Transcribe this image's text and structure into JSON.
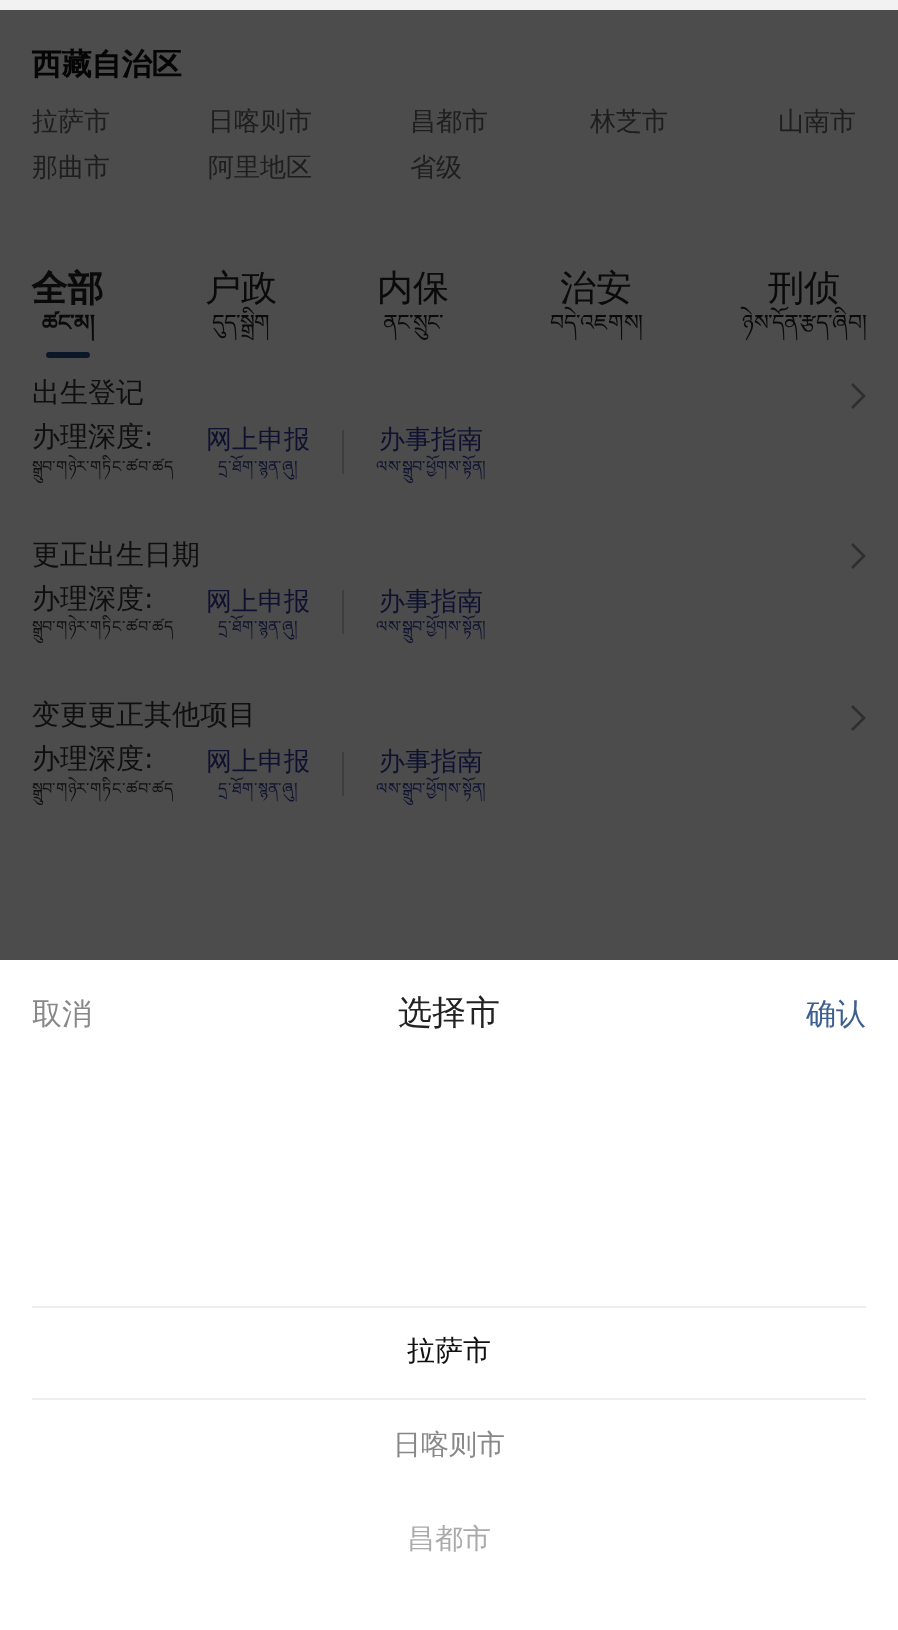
{
  "region": {
    "title": "西藏自治区",
    "cities": [
      "拉萨市",
      "日喀则市",
      "昌都市",
      "林芝市",
      "山南市",
      "那曲市",
      "阿里地区",
      "省级"
    ]
  },
  "tabs": [
    {
      "label": "全部",
      "sub": "ཚང་མ།",
      "selected": true
    },
    {
      "label": "户政",
      "sub": "དུད་སྒྲིག",
      "selected": false
    },
    {
      "label": "内保",
      "sub": "ནང་སྲུང་",
      "selected": false
    },
    {
      "label": "治安",
      "sub": "བདེ་འཇགས།",
      "selected": false
    },
    {
      "label": "刑侦",
      "sub": "ཉེས་དོན་རྩད་ཞིབ།",
      "selected": false
    }
  ],
  "services": [
    {
      "title": "出生登记",
      "depth": "办理深度:",
      "depth_tib": "སྒྲུབ་གཉེར་གཏིང་ཚབ་ཚད",
      "online": "网上申报",
      "online_tib": "དྲ་ཐོག་སྙན་ཞུ།",
      "guide": "办事指南",
      "guide_tib": "ལས་སྒྲུབ་ཕྱོགས་སྟོན།"
    },
    {
      "title": "更正出生日期",
      "depth": "办理深度:",
      "depth_tib": "སྒྲུབ་གཉེར་གཏིང་ཚབ་ཚད",
      "online": "网上申报",
      "online_tib": "དྲ་ཐོག་སྙན་ཞུ།",
      "guide": "办事指南",
      "guide_tib": "ལས་སྒྲུབ་ཕྱོགས་སྟོན།"
    },
    {
      "title": "变更更正其他项目",
      "depth": "办理深度:",
      "depth_tib": "སྒྲུབ་གཉེར་གཏིང་ཚབ་ཚད",
      "online": "网上申报",
      "online_tib": "དྲ་ཐོག་སྙན་ཞུ།",
      "guide": "办事指南",
      "guide_tib": "ལས་སྒྲུབ་ཕྱོགས་སྟོན།"
    }
  ],
  "picker": {
    "cancel": "取消",
    "title": "选择市",
    "confirm": "确认",
    "options": [
      {
        "label": "拉萨市",
        "selected": true
      },
      {
        "label": "日喀则市",
        "selected": false
      },
      {
        "label": "昌都市",
        "selected": false
      }
    ]
  }
}
